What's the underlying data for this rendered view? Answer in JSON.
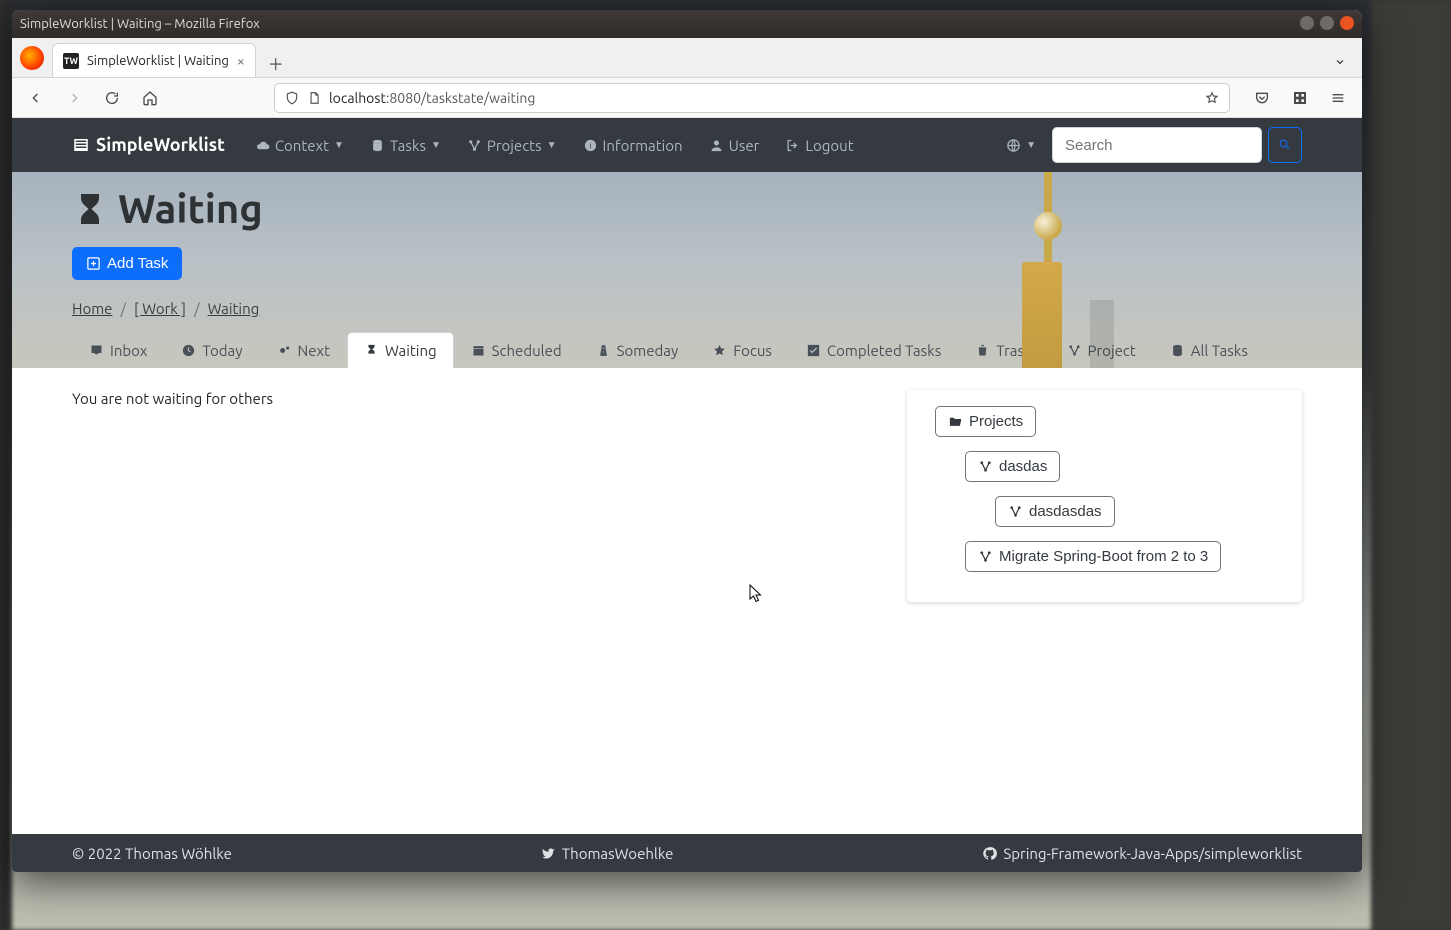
{
  "window": {
    "title": "SimpleWorklist | Waiting – Mozilla Firefox"
  },
  "browser": {
    "tab_title": "SimpleWorklist | Waiting",
    "url_host": "localhost",
    "url_path": ":8080/taskstate/waiting"
  },
  "navbar": {
    "brand": "SimpleWorklist",
    "items": {
      "context": "Context",
      "tasks": "Tasks",
      "projects": "Projects",
      "information": "Information",
      "user": "User",
      "logout": "Logout"
    },
    "search_placeholder": "Search"
  },
  "page": {
    "title": "Waiting",
    "add_task": "Add Task",
    "breadcrumb": {
      "home": "Home",
      "context": "[ Work ]",
      "current": "Waiting"
    },
    "tabs": {
      "inbox": "Inbox",
      "today": "Today",
      "next": "Next",
      "waiting": "Waiting",
      "scheduled": "Scheduled",
      "someday": "Someday",
      "focus": "Focus",
      "completed": "Completed Tasks",
      "trash": "Trash",
      "project": "Project",
      "all": "All Tasks"
    },
    "empty_message": "You are not waiting for others"
  },
  "sidebar": {
    "root": "Projects",
    "items": [
      {
        "label": "dasdas",
        "indent": 1
      },
      {
        "label": "dasdasdas",
        "indent": 2
      },
      {
        "label": "Migrate Spring-Boot from 2 to 3",
        "indent": 1
      }
    ]
  },
  "footer": {
    "copyright": "© 2022 Thomas Wöhlke",
    "twitter": "ThomasWoehlke",
    "github": "Spring-Framework-Java-Apps/simpleworklist"
  }
}
